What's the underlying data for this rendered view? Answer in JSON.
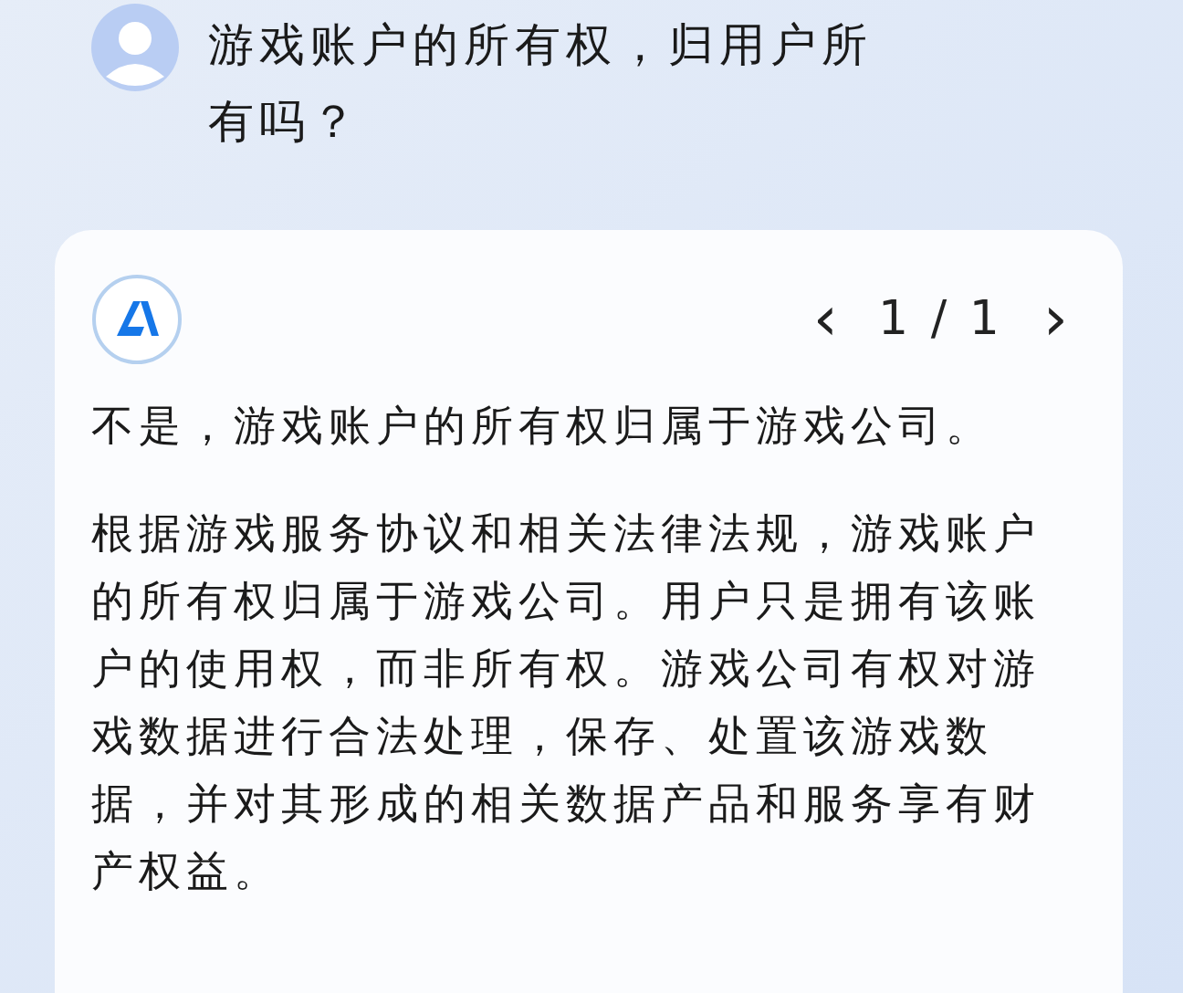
{
  "question": "游戏账户的所有权，归用户所有吗？",
  "answer": {
    "pager": {
      "prev": "‹",
      "current": "1 / 1",
      "next": "›"
    },
    "paragraphs": [
      "不是，游戏账户的所有权归属于游戏公司。",
      "根据游戏服务协议和相关法律法规，游戏账户的所有权归属于游戏公司。用户只是拥有该账户的使用权，而非所有权。游戏公司有权对游戏数据进行合法处理，保存、处置该游戏数据，并对其形成的相关数据产品和服务享有财产权益。"
    ]
  }
}
